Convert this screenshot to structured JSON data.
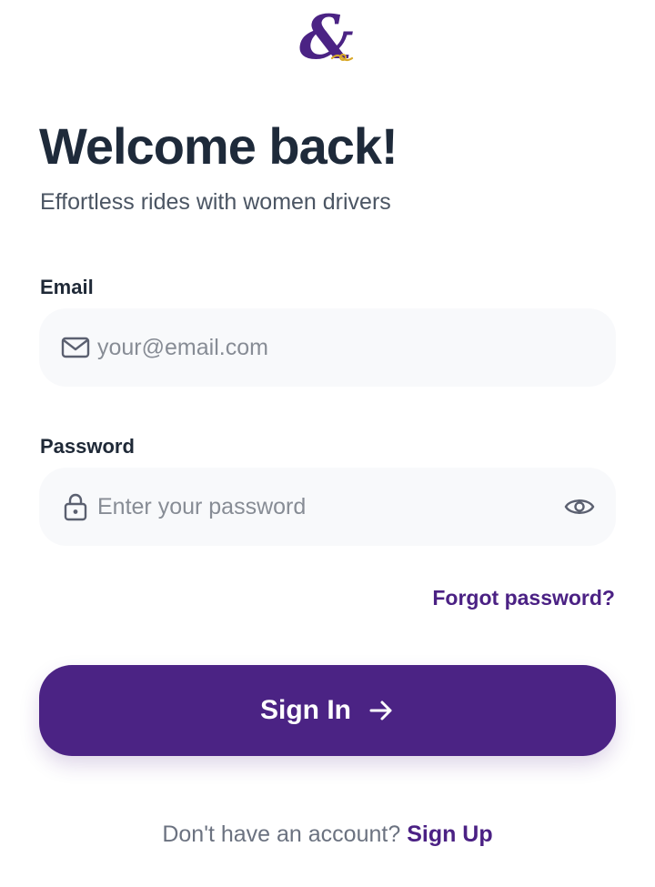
{
  "header": {
    "logo_icon": "ampersand-logo-icon"
  },
  "hero": {
    "title": "Welcome back!",
    "subtitle": "Effortless rides with women drivers"
  },
  "form": {
    "email": {
      "label": "Email",
      "placeholder": "your@email.com",
      "value": "",
      "icon": "mail-icon"
    },
    "password": {
      "label": "Password",
      "placeholder": "Enter your password",
      "value": "",
      "icon": "lock-icon",
      "toggle_icon": "eye-icon"
    },
    "forgot_password": "Forgot password?",
    "submit_label": "Sign In",
    "submit_icon": "arrow-right-icon"
  },
  "footer": {
    "prompt": "Don't have an account?",
    "signup_label": "Sign Up"
  },
  "colors": {
    "brand_purple": "#4b2384",
    "accent_gold": "#d9a92b",
    "title_text": "#1e2a3a",
    "input_bg": "#f8f9fb"
  }
}
